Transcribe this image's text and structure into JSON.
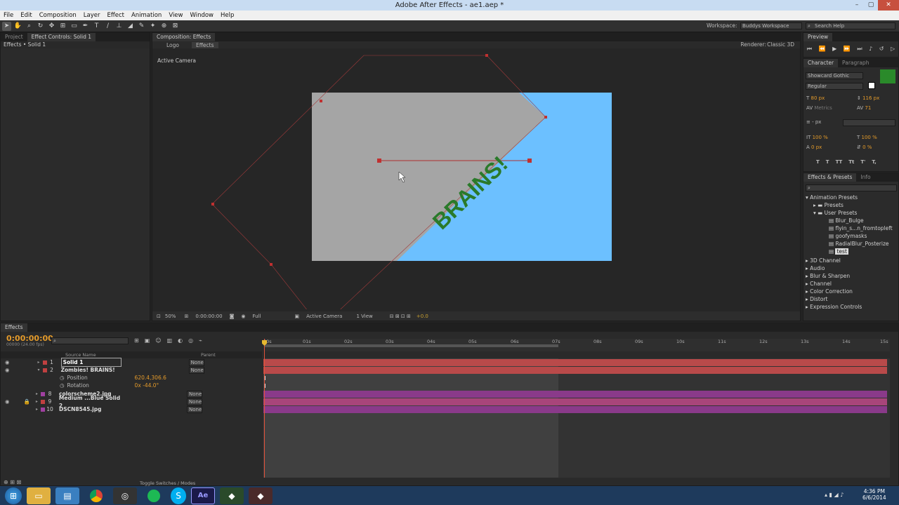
{
  "window": {
    "title": "Adobe After Effects - ae1.aep *"
  },
  "menu": [
    "File",
    "Edit",
    "Composition",
    "Layer",
    "Effect",
    "Animation",
    "View",
    "Window",
    "Help"
  ],
  "workspace": {
    "label": "Workspace:",
    "value": "Buddys Workspace",
    "search_placeholder": "Search Help"
  },
  "project_panel": {
    "tabs": [
      "Project",
      "Effect Controls: Solid 1"
    ],
    "breadcrumb": "Effects • Solid 1"
  },
  "comp_panel": {
    "tab": "Composition: Effects",
    "crumbs": [
      "Logo",
      "Effects"
    ],
    "renderer_label": "Renderer:",
    "renderer": "Classic 3D",
    "camera_label": "Active Camera",
    "text_layer": "BRAINS!",
    "footer": {
      "zoom": "50%",
      "time": "0:00:00:00",
      "resolution": "Full",
      "camera": "Active Camera",
      "views": "1 View",
      "offset": "+0.0"
    }
  },
  "preview": {
    "title": "Preview"
  },
  "character": {
    "tabs": [
      "Character",
      "Paragraph"
    ],
    "font": "Showcard Gothic",
    "style": "Regular",
    "size": "80 px",
    "leading": "116 px",
    "kerning": "Metrics",
    "tracking": "71",
    "stroke": "- px",
    "vscale": "100 %",
    "hscale": "100 %",
    "baseline": "0 px",
    "tsume": "0 %",
    "fill_color": "#2a8a2a"
  },
  "effects_presets": {
    "tabs": [
      "Effects & Presets",
      "Info"
    ],
    "tree": [
      "Animation Presets",
      "Presets",
      "User Presets",
      "Blur_Bulge",
      "flyin_s...n_fromtopleft",
      "goofymasks",
      "RadialBlur_Posterize",
      "test"
    ],
    "categories": [
      "3D Channel",
      "Audio",
      "Blur & Sharpen",
      "Channel",
      "Color Correction",
      "Distort",
      "Expression Controls"
    ]
  },
  "timeline": {
    "tab": "Effects",
    "timecode": "0:00:00:00",
    "fps": "00000 (24.00 fps)",
    "col_source": "Source Name",
    "col_parent": "Parent",
    "ticks": [
      "00s",
      "01s",
      "02s",
      "03s",
      "04s",
      "05s",
      "06s",
      "07s",
      "08s",
      "09s",
      "10s",
      "11s",
      "12s",
      "13s",
      "14s",
      "15s"
    ],
    "layers": [
      {
        "num": "1",
        "name": "Solid 1",
        "color": "#c04040",
        "parent": "None"
      },
      {
        "num": "2",
        "name": "Zombies! BRAINS!",
        "color": "#c04040",
        "parent": "None"
      },
      {
        "num": "8",
        "name": "colorscheme2.jpg",
        "color": "#a040a0",
        "parent": "None"
      },
      {
        "num": "9",
        "name": "Medium ...Blue Solid 2",
        "color": "#c04040",
        "parent": "None"
      },
      {
        "num": "10",
        "name": "DSCN8545.jpg",
        "color": "#a040a0",
        "parent": "None"
      }
    ],
    "props": [
      {
        "name": "Position",
        "value": "620.4,306.6"
      },
      {
        "name": "Rotation",
        "value": "0x -44.0°"
      }
    ],
    "footer": "Toggle Switches / Modes"
  },
  "taskbar": {
    "time": "4:36 PM",
    "date": "6/6/2014",
    "apps": [
      "start",
      "explorer",
      "store",
      "chrome",
      "steam",
      "spotify",
      "skype",
      "after-effects",
      "app-green",
      "app-red"
    ]
  }
}
